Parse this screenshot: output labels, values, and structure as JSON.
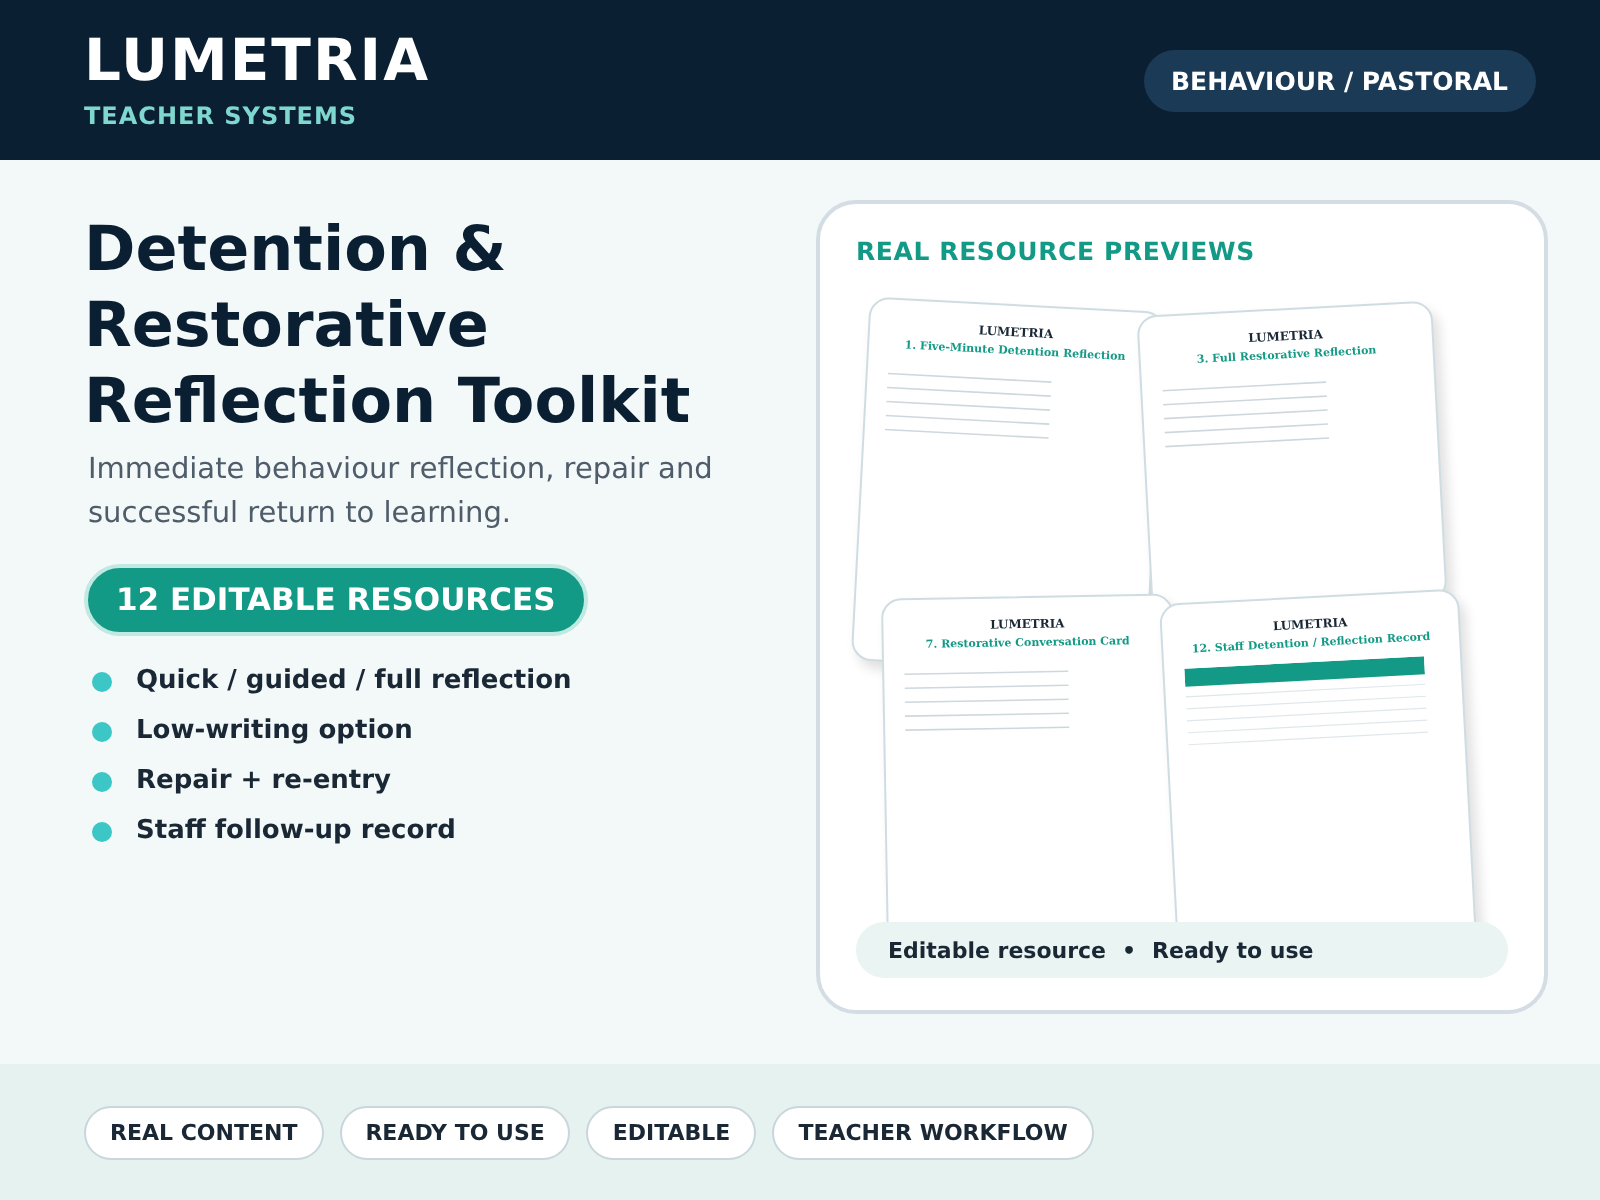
{
  "header": {
    "brand": "LUMETRIA",
    "tagline": "TEACHER SYSTEMS",
    "badge": "BEHAVIOUR / PASTORAL"
  },
  "hero": {
    "title": "Detention & Restorative Reflection Toolkit",
    "subtitle": "Immediate behaviour reflection, repair and successful return to learning.",
    "pill": "12 EDITABLE RESOURCES",
    "features": [
      "Quick / guided / full reflection",
      "Low-writing option",
      "Repair + re-entry",
      "Staff follow-up record"
    ]
  },
  "previews": {
    "title": "REAL RESOURCE PREVIEWS",
    "sheets": [
      {
        "kind": "questions",
        "brand": "LUMETRIA",
        "title": "1. Five-Minute Detention Reflection"
      },
      {
        "kind": "questions",
        "brand": "LUMETRIA",
        "title": "3. Full Restorative Reflection"
      },
      {
        "kind": "questions",
        "brand": "LUMETRIA",
        "title": "7. Restorative Conversation Card"
      },
      {
        "kind": "table",
        "brand": "LUMETRIA",
        "title": "12. Staff Detention / Reflection Record"
      }
    ],
    "note": [
      "Editable resource",
      "•",
      "Ready to use"
    ]
  },
  "footer": {
    "tags": [
      "REAL CONTENT",
      "READY TO USE",
      "EDITABLE",
      "TEACHER WORKFLOW"
    ]
  }
}
